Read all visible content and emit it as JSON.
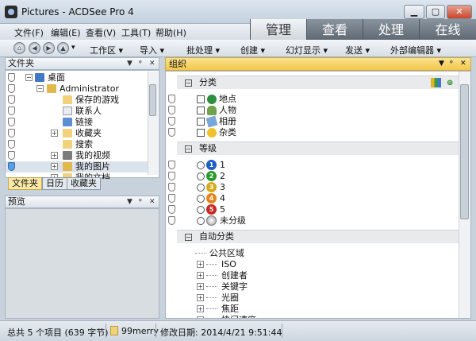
{
  "window": {
    "title": "Pictures - ACDSee Pro 4",
    "min": "▁",
    "max": "▢",
    "close": "✕"
  },
  "menu": [
    "文件(F)",
    "编辑(E)",
    "查看(V)",
    "工具(T)",
    "帮助(H)"
  ],
  "modes": [
    "管理",
    "查看",
    "处理",
    "在线"
  ],
  "toolbar": [
    "工作区",
    "导入",
    "批处理",
    "创建",
    "幻灯显示",
    "发送",
    "外部编辑器"
  ],
  "folder_panel": {
    "title": "文件夹",
    "tree": [
      "桌面",
      "Administrator",
      "保存的游戏",
      "联系人",
      "链接",
      "收藏夹",
      "搜索",
      "我的视频",
      "我的图片",
      "我的文档"
    ],
    "tabs": [
      "文件夹",
      "日历",
      "收藏夹"
    ]
  },
  "preview_panel": {
    "title": "预览"
  },
  "organize": {
    "title": "组织",
    "categories_title": "分类",
    "categories": [
      "地点",
      "人物",
      "相册",
      "杂类"
    ],
    "ratings_title": "等级",
    "ratings": [
      "1",
      "2",
      "3",
      "4",
      "5",
      "未分级"
    ],
    "rating_colors": [
      "#1e5cc8",
      "#2a9a2a",
      "#d9a91c",
      "#e5861a",
      "#c8261e",
      "#9a9a9a"
    ],
    "auto_title": "自动分类",
    "auto_root": "公共区域",
    "auto_items": [
      "ISO",
      "创建者",
      "关键字",
      "光圈",
      "焦距",
      "快门速度"
    ]
  },
  "status": {
    "summary": "总共 5 个项目 (639 字节)",
    "folder": "99merry",
    "modified": "修改日期: 2014/4/21 9:51:44"
  }
}
